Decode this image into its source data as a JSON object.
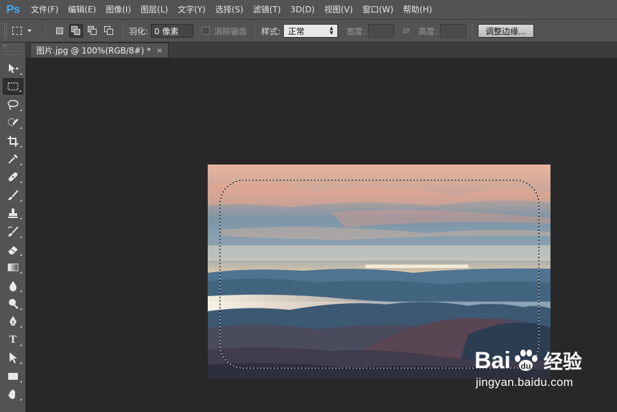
{
  "app": {
    "logo": "Ps"
  },
  "menu": [
    "文件(F)",
    "编辑(E)",
    "图像(I)",
    "图层(L)",
    "文字(Y)",
    "选择(S)",
    "滤镜(T)",
    "3D(D)",
    "视图(V)",
    "窗口(W)",
    "帮助(H)"
  ],
  "options": {
    "feather_label": "羽化:",
    "feather_value": "0 像素",
    "antialias_label": "消除锯齿",
    "style_label": "样式:",
    "style_value": "正常",
    "width_label": "宽度:",
    "height_label": "高度:",
    "refine_edge_button": "调整边缘..."
  },
  "document": {
    "tab_title": "图片.jpg @ 100%(RGB/8#) *",
    "close": "×"
  },
  "tools": [
    {
      "name": "move-tool",
      "icon": "move-icon",
      "active": false
    },
    {
      "name": "rect-marquee-tool",
      "icon": "rect-marquee-icon",
      "active": true
    },
    {
      "name": "lasso-tool",
      "icon": "lasso-icon",
      "active": false
    },
    {
      "name": "quick-selection-tool",
      "icon": "quick-selection-icon",
      "active": false
    },
    {
      "name": "crop-tool",
      "icon": "crop-icon",
      "active": false
    },
    {
      "name": "eyedropper-tool",
      "icon": "eyedropper-icon",
      "active": false
    },
    {
      "name": "healing-brush-tool",
      "icon": "bandage-icon",
      "active": false
    },
    {
      "name": "brush-tool",
      "icon": "brush-icon",
      "active": false
    },
    {
      "name": "clone-stamp-tool",
      "icon": "stamp-icon",
      "active": false
    },
    {
      "name": "history-brush-tool",
      "icon": "history-brush-icon",
      "active": false
    },
    {
      "name": "eraser-tool",
      "icon": "eraser-icon",
      "active": false
    },
    {
      "name": "gradient-tool",
      "icon": "gradient-icon",
      "active": false
    },
    {
      "name": "blur-tool",
      "icon": "drop-icon",
      "active": false
    },
    {
      "name": "dodge-tool",
      "icon": "dodge-icon",
      "active": false
    },
    {
      "name": "pen-tool",
      "icon": "pen-icon",
      "active": false
    },
    {
      "name": "type-tool",
      "icon": "type-icon",
      "active": false,
      "glyph": "T"
    },
    {
      "name": "path-selection-tool",
      "icon": "arrow-icon",
      "active": false
    },
    {
      "name": "rectangle-shape-tool",
      "icon": "rectangle-icon",
      "active": false
    },
    {
      "name": "hand-tool",
      "icon": "hand-icon",
      "active": false
    }
  ],
  "watermark": {
    "brand_left": "Bai",
    "brand_right": "u",
    "brand_cn": "经验",
    "url": "jingyan.baidu.com"
  },
  "colors": {
    "ui_panel": "#535353",
    "canvas_bg": "#282828",
    "ps_logo": "#49a8f0"
  }
}
